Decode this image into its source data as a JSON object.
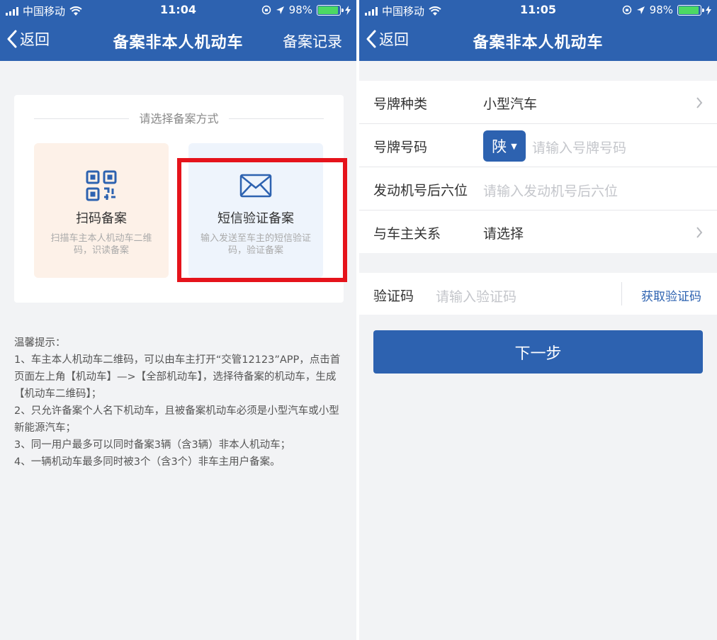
{
  "colors": {
    "primary": "#2d62b0",
    "highlight": "#e5131b",
    "background": "#f2f3f5"
  },
  "left": {
    "status": {
      "carrier": "中国移动",
      "time": "11:04",
      "battery": "98%"
    },
    "nav": {
      "back": "返回",
      "title": "备案非本人机动车",
      "right": "备案记录"
    },
    "card": {
      "title": "请选择备案方式",
      "options": [
        {
          "icon": "qr-code-icon",
          "name": "扫码备案",
          "desc": "扫描车主本人机动车二维码，识读备案"
        },
        {
          "icon": "envelope-icon",
          "name": "短信验证备案",
          "desc": "输入发送至车主的短信验证码，验证备案"
        }
      ]
    },
    "tips": {
      "heading": "温馨提示：",
      "items": [
        "1、车主本人机动车二维码，可以由车主打开“交管12123”APP，点击首页面左上角【机动车】—>【全部机动车】，选择待备案的机动车，生成【机动车二维码】；",
        "2、只允许备案个人名下机动车，且被备案机动车必须是小型汽车或小型新能源汽车；",
        "3、同一用户最多可以同时备案3辆（含3辆）非本人机动车；",
        "4、一辆机动车最多同时被3个（含3个）非车主用户备案。"
      ]
    }
  },
  "right": {
    "status": {
      "carrier": "中国移动",
      "time": "11:05",
      "battery": "98%"
    },
    "nav": {
      "back": "返回",
      "title": "备案非本人机动车"
    },
    "form": {
      "plate_type": {
        "label": "号牌种类",
        "value": "小型汽车"
      },
      "plate_number": {
        "label": "号牌号码",
        "province": "陕",
        "placeholder": "请输入号牌号码"
      },
      "engine": {
        "label": "发动机号后六位",
        "placeholder": "请输入发动机号后六位"
      },
      "relation": {
        "label": "与车主关系",
        "value": "请选择"
      },
      "code": {
        "label": "验证码",
        "placeholder": "请输入验证码",
        "button": "获取验证码"
      },
      "next": "下一步"
    }
  }
}
